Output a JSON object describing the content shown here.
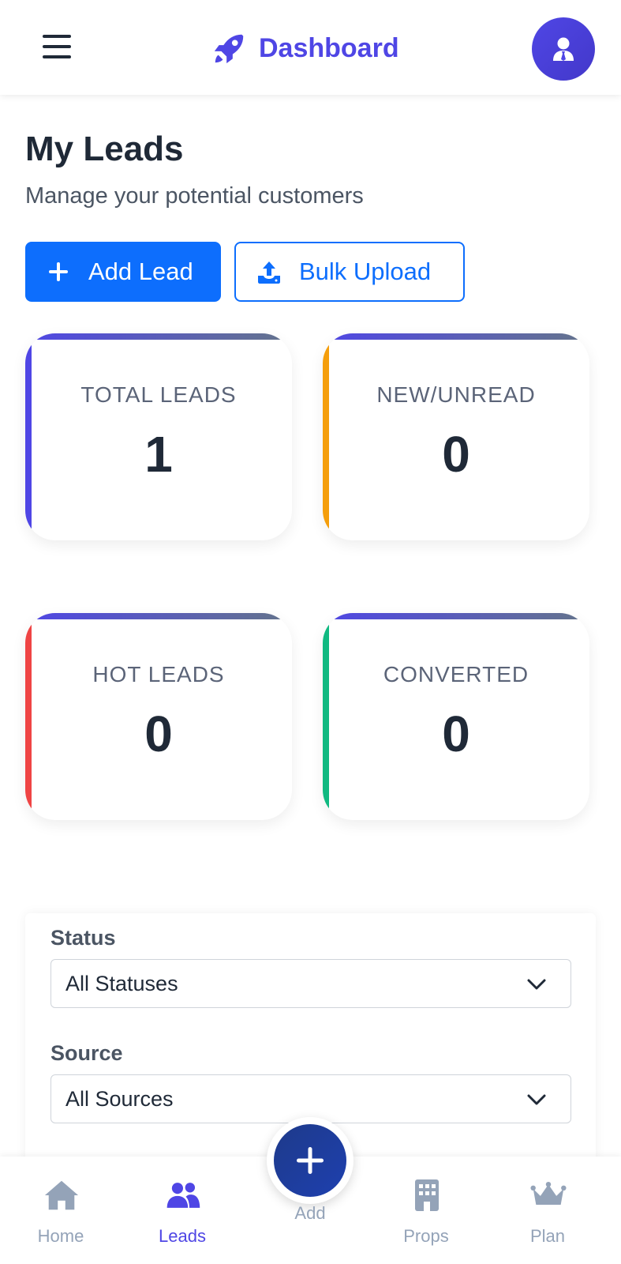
{
  "header": {
    "title": "Dashboard",
    "brand_color": "#4f46e5",
    "menu_icon": "hamburger-menu-icon",
    "brand_icon": "rocket-icon",
    "avatar_icon": "user-tie-icon"
  },
  "page": {
    "title": "My Leads",
    "subtitle": "Manage your potential customers"
  },
  "actions": {
    "add_label": "Add Lead",
    "bulk_label": "Bulk Upload",
    "primary_color": "#0d6efd"
  },
  "stats": [
    {
      "label": "TOTAL LEADS",
      "value": "1",
      "accent": "#4f46e5"
    },
    {
      "label": "NEW/UNREAD",
      "value": "0",
      "accent": "#f59e0b"
    },
    {
      "label": "HOT LEADS",
      "value": "0",
      "accent": "#ef4444"
    },
    {
      "label": "CONVERTED",
      "value": "0",
      "accent": "#10b981"
    }
  ],
  "filters": {
    "status_label": "Status",
    "status_value": "All Statuses",
    "source_label": "Source",
    "source_value": "All Sources"
  },
  "bottom_nav": {
    "items": [
      {
        "label": "Home",
        "icon": "home-icon"
      },
      {
        "label": "Leads",
        "icon": "users-icon",
        "active": true
      },
      {
        "label": "Add",
        "icon": "plus-icon"
      },
      {
        "label": "Props",
        "icon": "building-icon"
      },
      {
        "label": "Plan",
        "icon": "crown-icon"
      }
    ]
  }
}
